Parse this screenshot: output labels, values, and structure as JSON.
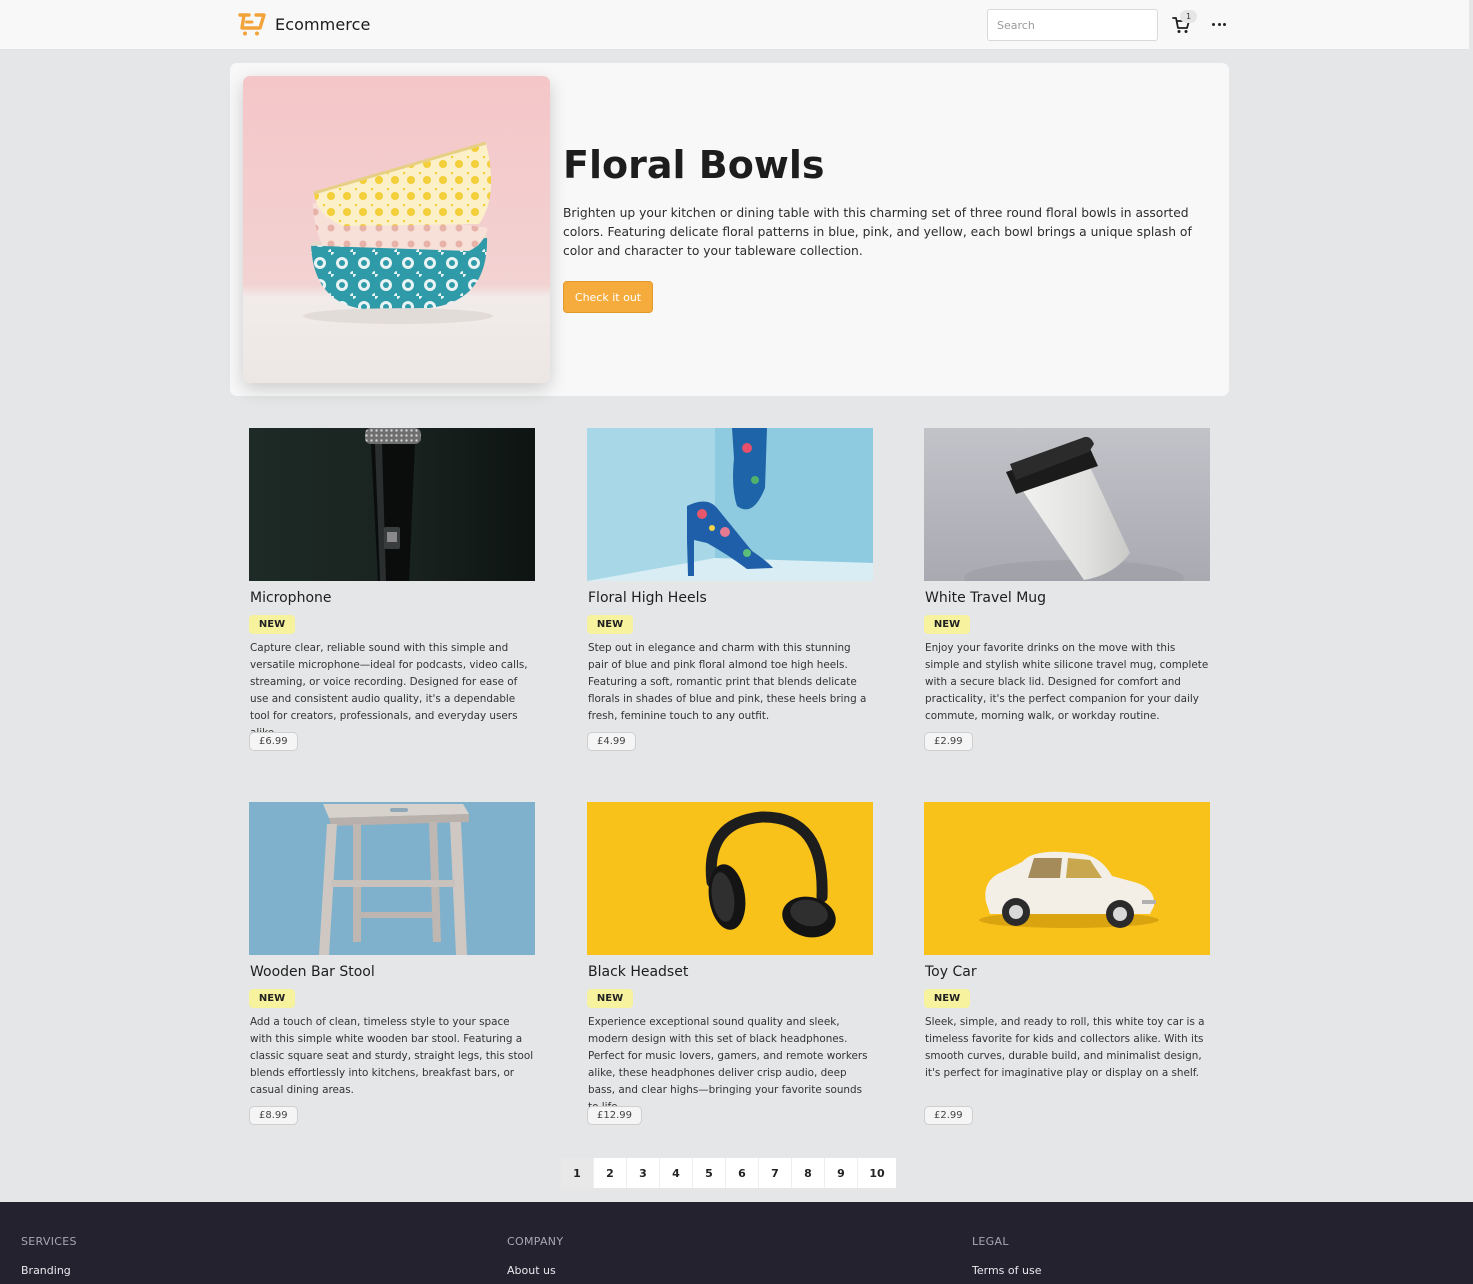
{
  "navbar": {
    "brand": "Ecommerce",
    "search_placeholder": "Search",
    "cart_count": "1"
  },
  "hero": {
    "title": "Floral Bowls",
    "description": "Brighten up your kitchen or dining table with this charming set of three round floral bowls in assorted colors. Featuring delicate floral patterns in blue, pink, and yellow, each bowl brings a unique splash of color and character to your tableware collection.",
    "button_label": "Check it out"
  },
  "products": [
    {
      "title": "Microphone",
      "badge": "NEW",
      "description": "Capture clear, reliable sound with this simple and versatile microphone—ideal for podcasts, video calls, streaming, or voice recording. Designed for ease of use and consistent audio quality, it's a dependable tool for creators, professionals, and everyday users alike.",
      "price": "£6.99"
    },
    {
      "title": "Floral High Heels",
      "badge": "NEW",
      "description": "Step out in elegance and charm with this stunning pair of blue and pink floral almond toe high heels. Featuring a soft, romantic print that blends delicate florals in shades of blue and pink, these heels bring a fresh, feminine touch to any outfit.",
      "price": "£4.99"
    },
    {
      "title": "White Travel Mug",
      "badge": "NEW",
      "description": "Enjoy your favorite drinks on the move with this simple and stylish white silicone travel mug, complete with a secure black lid. Designed for comfort and practicality, it's the perfect companion for your daily commute, morning walk, or workday routine.",
      "price": "£2.99"
    },
    {
      "title": "Wooden Bar Stool",
      "badge": "NEW",
      "description": "Add a touch of clean, timeless style to your space with this simple white wooden bar stool. Featuring a classic square seat and sturdy, straight legs, this stool blends effortlessly into kitchens, breakfast bars, or casual dining areas.",
      "price": "£8.99"
    },
    {
      "title": "Black Headset",
      "badge": "NEW",
      "description": "Experience exceptional sound quality and sleek, modern design with this set of black headphones. Perfect for music lovers, gamers, and remote workers alike, these headphones deliver crisp audio, deep bass, and clear highs—bringing your favorite sounds to life.",
      "price": "£12.99"
    },
    {
      "title": "Toy Car",
      "badge": "NEW",
      "description": "Sleek, simple, and ready to roll, this white toy car is a timeless favorite for kids and collectors alike. With its smooth curves, durable build, and minimalist design, it's perfect for imaginative play or display on a shelf.",
      "price": "£2.99"
    }
  ],
  "pagination": {
    "pages": [
      "1",
      "2",
      "3",
      "4",
      "5",
      "6",
      "7",
      "8",
      "9",
      "10"
    ],
    "active": "1"
  },
  "footer": {
    "columns": [
      {
        "heading": "SERVICES",
        "link": "Branding"
      },
      {
        "heading": "COMPANY",
        "link": "About us"
      },
      {
        "heading": "LEGAL",
        "link": "Terms of use"
      }
    ]
  },
  "colors": {
    "accent": "#f6ac3d",
    "badge": "#f6f29e",
    "footer_bg": "#25222f",
    "page_bg": "#e4e6e7"
  }
}
